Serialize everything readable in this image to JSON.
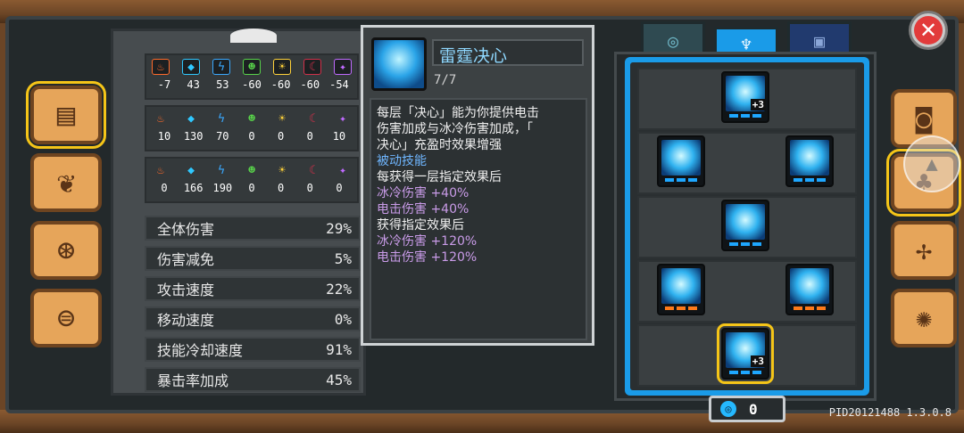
{
  "resistances": {
    "row1": [
      "-7",
      "43",
      "53",
      "-60",
      "-60",
      "-60",
      "-54"
    ],
    "row2": [
      "10",
      "130",
      "70",
      "0",
      "0",
      "0",
      "10"
    ],
    "row3": [
      "0",
      "166",
      "190",
      "0",
      "0",
      "0",
      "0"
    ],
    "elements": [
      {
        "name": "fire-icon",
        "color": "#ff6a2a",
        "glyph": "♨"
      },
      {
        "name": "ice-icon",
        "color": "#2fc8ff",
        "glyph": "◆"
      },
      {
        "name": "lightning-icon",
        "color": "#3aa9ff",
        "glyph": "ϟ"
      },
      {
        "name": "poison-icon",
        "color": "#58d34a",
        "glyph": "☻"
      },
      {
        "name": "light-icon",
        "color": "#ffd23a",
        "glyph": "☀"
      },
      {
        "name": "dark-icon",
        "color": "#d0304a",
        "glyph": "☾"
      },
      {
        "name": "arcane-icon",
        "color": "#c06aff",
        "glyph": "✦"
      }
    ]
  },
  "stats": [
    {
      "label": "全体伤害",
      "value": "29%"
    },
    {
      "label": "伤害减免",
      "value": "5%"
    },
    {
      "label": "攻击速度",
      "value": "22%"
    },
    {
      "label": "移动速度",
      "value": "0%"
    },
    {
      "label": "技能冷却速度",
      "value": "91%"
    },
    {
      "label": "暴击率加成",
      "value": "45%"
    }
  ],
  "skill": {
    "name": "雷霆决心",
    "level": "7/7",
    "desc": [
      {
        "text": "每层「决心」能为你提供电击",
        "color": "white"
      },
      {
        "text": "伤害加成与冰冷伤害加成，「",
        "color": "white"
      },
      {
        "text": "决心」充盈时效果增强",
        "color": "white"
      },
      {
        "text": "被动技能",
        "color": "blue"
      },
      {
        "text": "每获得一层指定效果后",
        "color": "white"
      },
      {
        "text": "冰冷伤害 +40%",
        "color": "purple"
      },
      {
        "text": "电击伤害 +40%",
        "color": "purple"
      },
      {
        "text": "获得指定效果后",
        "color": "white"
      },
      {
        "text": "冰冷伤害 +120%",
        "color": "purple"
      },
      {
        "text": "电击伤害 +120%",
        "color": "purple"
      }
    ]
  },
  "tree": {
    "node_plus_label": "+3"
  },
  "currency": {
    "amount": "0"
  },
  "version": "PID20121488 1.3.0.8"
}
